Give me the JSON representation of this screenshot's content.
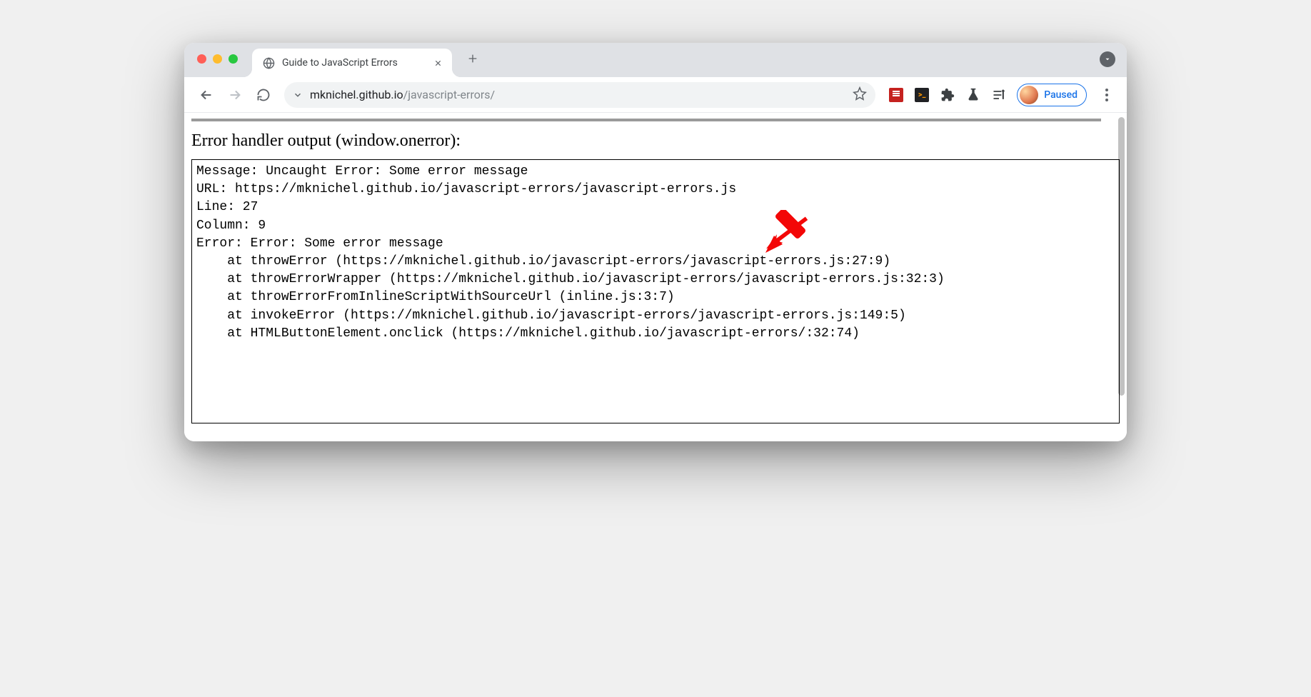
{
  "tab": {
    "title": "Guide to JavaScript Errors"
  },
  "url": {
    "host": "mknichel.github.io",
    "path": "/javascript-errors/"
  },
  "profile": {
    "status": "Paused"
  },
  "page": {
    "section_title": "Error handler output (window.onerror):",
    "output": "Message: Uncaught Error: Some error message\nURL: https://mknichel.github.io/javascript-errors/javascript-errors.js\nLine: 27\nColumn: 9\nError: Error: Some error message\n    at throwError (https://mknichel.github.io/javascript-errors/javascript-errors.js:27:9)\n    at throwErrorWrapper (https://mknichel.github.io/javascript-errors/javascript-errors.js:32:3)\n    at throwErrorFromInlineScriptWithSourceUrl (inline.js:3:7)\n    at invokeError (https://mknichel.github.io/javascript-errors/javascript-errors.js:149:5)\n    at HTMLButtonElement.onclick (https://mknichel.github.io/javascript-errors/:32:74)"
  }
}
